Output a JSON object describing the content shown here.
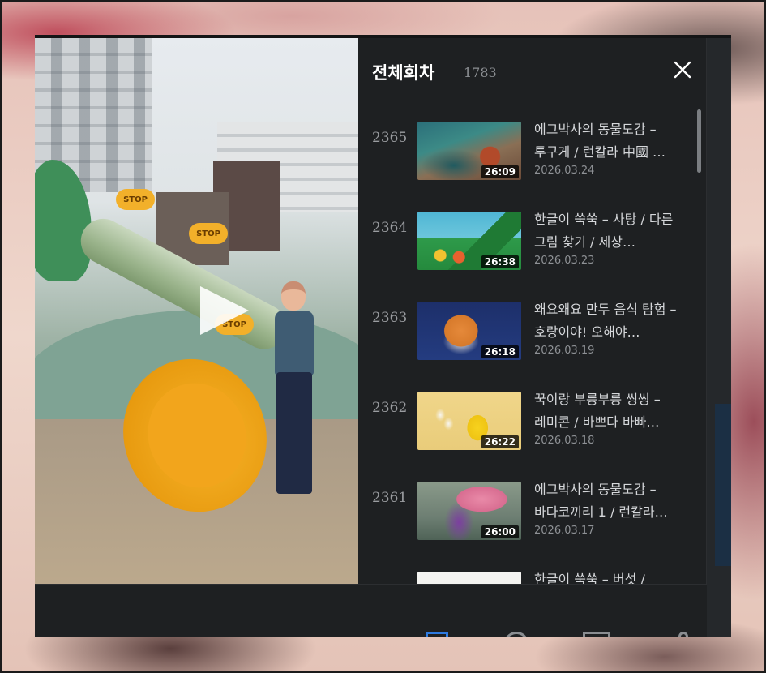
{
  "panel": {
    "title": "전체회차",
    "count": "1783"
  },
  "episodes": [
    {
      "number": "2365",
      "title": "에그박사의 동물도감 – 투구게 / 런칼라 中國 …",
      "date": "2026.03.24",
      "duration": "26:09",
      "thumb_theme": "coral-crab"
    },
    {
      "number": "2364",
      "title": "한글이 쑥쑥 – 사탕 / 다른 그림 찾기 / 세상…",
      "date": "2026.03.23",
      "duration": "26:38",
      "thumb_theme": "green-mountains"
    },
    {
      "number": "2363",
      "title": "왜요왜요 만두 음식 탐험 – 호랑이야! 오해야…",
      "date": "2026.03.19",
      "duration": "26:18",
      "thumb_theme": "tiger"
    },
    {
      "number": "2362",
      "title": "꾹이랑 부릉부릉 씽씽 – 레미콘 / 바쁘다 바빠…",
      "date": "2026.03.18",
      "duration": "26:22",
      "thumb_theme": "chick"
    },
    {
      "number": "2361",
      "title": "에그박사의 동물도감 – 바다코끼리 1 / 런칼라…",
      "date": "2026.03.17",
      "duration": "26:00",
      "thumb_theme": "umbrella"
    },
    {
      "number": "",
      "title": "한글이 쑥쑥 – 버섯 /",
      "date": "",
      "duration": "",
      "thumb_theme": "partial"
    }
  ],
  "video": {
    "sign_text": "STOP"
  },
  "colors": {
    "panel_bg": "#1e2022",
    "accent_blue": "#2e7ae0",
    "text_primary": "#ffffff",
    "text_secondary": "#8f9296"
  }
}
